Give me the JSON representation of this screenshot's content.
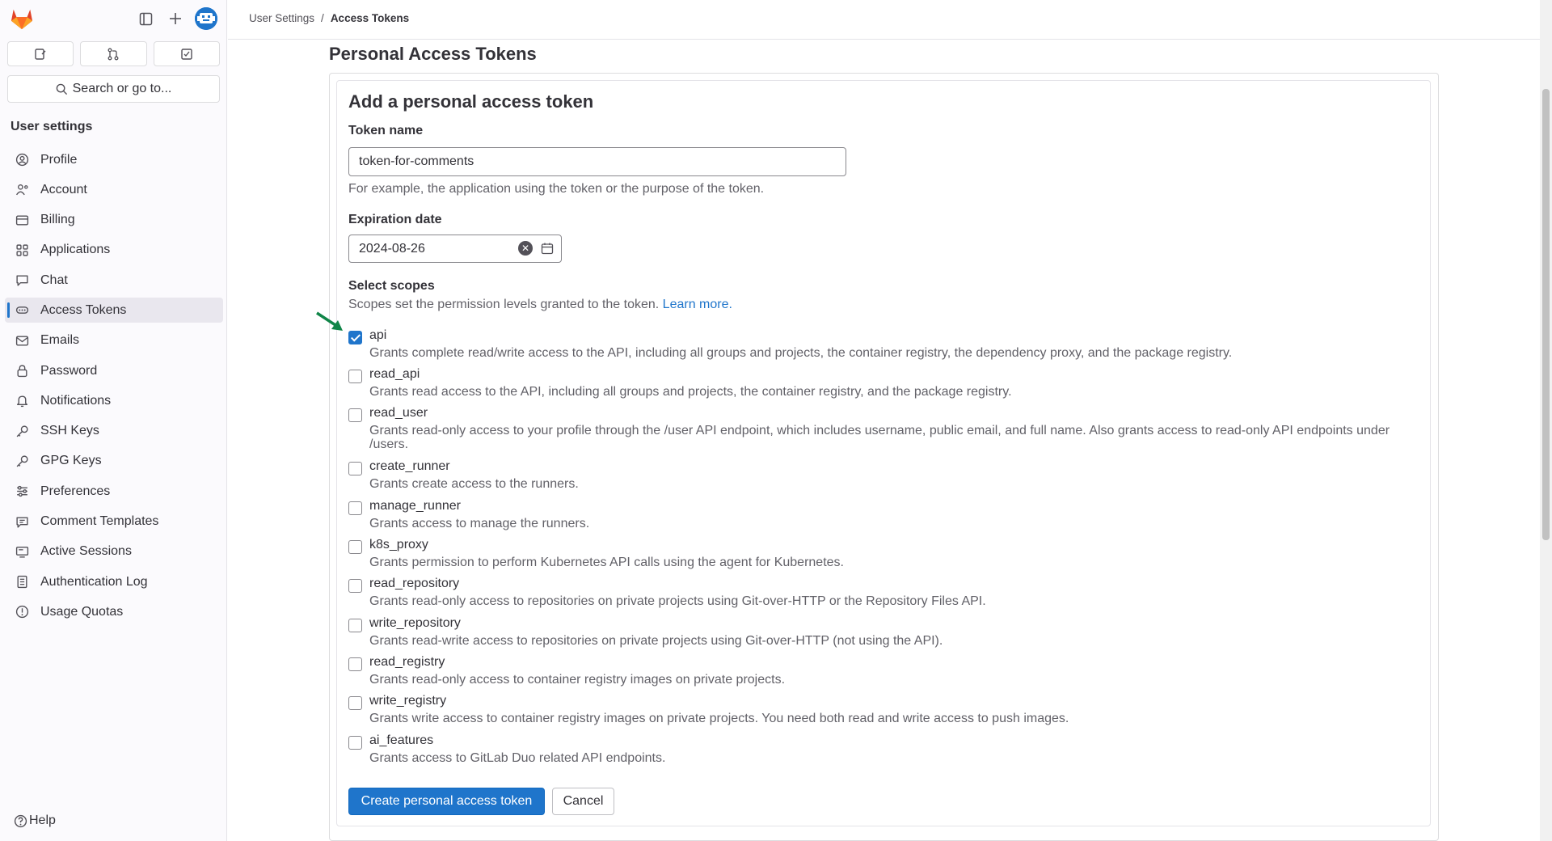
{
  "breadcrumb": {
    "parent": "User Settings",
    "separator": "/",
    "current": "Access Tokens"
  },
  "sidebar": {
    "search_label": "Search or go to...",
    "heading": "User settings",
    "items": [
      {
        "label": "Profile",
        "icon": "profile-icon"
      },
      {
        "label": "Account",
        "icon": "account-icon"
      },
      {
        "label": "Billing",
        "icon": "billing-icon"
      },
      {
        "label": "Applications",
        "icon": "applications-icon"
      },
      {
        "label": "Chat",
        "icon": "chat-icon"
      },
      {
        "label": "Access Tokens",
        "icon": "token-icon",
        "active": true
      },
      {
        "label": "Emails",
        "icon": "mail-icon"
      },
      {
        "label": "Password",
        "icon": "lock-icon"
      },
      {
        "label": "Notifications",
        "icon": "bell-icon"
      },
      {
        "label": "SSH Keys",
        "icon": "key-icon"
      },
      {
        "label": "GPG Keys",
        "icon": "key-icon"
      },
      {
        "label": "Preferences",
        "icon": "preferences-icon"
      },
      {
        "label": "Comment Templates",
        "icon": "comment-icon"
      },
      {
        "label": "Active Sessions",
        "icon": "monitor-icon"
      },
      {
        "label": "Authentication Log",
        "icon": "log-icon"
      },
      {
        "label": "Usage Quotas",
        "icon": "quota-icon"
      }
    ],
    "help_label": "Help"
  },
  "page": {
    "title": "Personal Access Tokens",
    "section_title": "Add a personal access token",
    "token_name_label": "Token name",
    "token_name_value": "token-for-comments",
    "token_name_help": "For example, the application using the token or the purpose of the token.",
    "expiration_label": "Expiration date",
    "expiration_value": "2024-08-26",
    "scopes_label": "Select scopes",
    "scopes_help": "Scopes set the permission levels granted to the token.",
    "learn_more": "Learn more.",
    "scopes": [
      {
        "name": "api",
        "checked": true,
        "desc": "Grants complete read/write access to the API, including all groups and projects, the container registry, the dependency proxy, and the package registry."
      },
      {
        "name": "read_api",
        "checked": false,
        "desc": "Grants read access to the API, including all groups and projects, the container registry, and the package registry."
      },
      {
        "name": "read_user",
        "checked": false,
        "desc": "Grants read-only access to your profile through the /user API endpoint, which includes username, public email, and full name. Also grants access to read-only API endpoints under /users."
      },
      {
        "name": "create_runner",
        "checked": false,
        "desc": "Grants create access to the runners."
      },
      {
        "name": "manage_runner",
        "checked": false,
        "desc": "Grants access to manage the runners."
      },
      {
        "name": "k8s_proxy",
        "checked": false,
        "desc": "Grants permission to perform Kubernetes API calls using the agent for Kubernetes."
      },
      {
        "name": "read_repository",
        "checked": false,
        "desc": "Grants read-only access to repositories on private projects using Git-over-HTTP or the Repository Files API."
      },
      {
        "name": "write_repository",
        "checked": false,
        "desc": "Grants read-write access to repositories on private projects using Git-over-HTTP (not using the API)."
      },
      {
        "name": "read_registry",
        "checked": false,
        "desc": "Grants read-only access to container registry images on private projects."
      },
      {
        "name": "write_registry",
        "checked": false,
        "desc": "Grants write access to container registry images on private projects. You need both read and write access to push images."
      },
      {
        "name": "ai_features",
        "checked": false,
        "desc": "Grants access to GitLab Duo related API endpoints."
      }
    ],
    "create_button": "Create personal access token",
    "cancel_button": "Cancel"
  },
  "colors": {
    "accent": "#1f75cb",
    "arrow": "#108548",
    "logo": "#e24329"
  }
}
